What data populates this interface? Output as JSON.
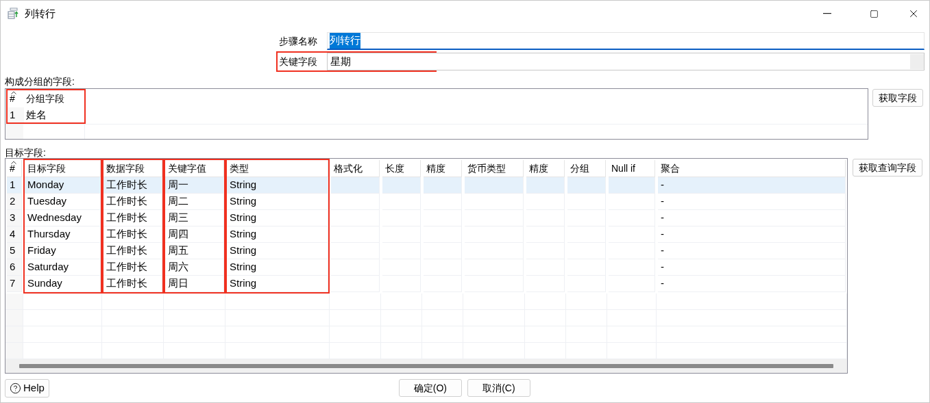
{
  "window": {
    "title": "列转行"
  },
  "step_name": {
    "label": "步骤名称",
    "value": "列转行",
    "text_selected": true
  },
  "key_field": {
    "label": "关键字段",
    "value": "星期",
    "highlighted": true
  },
  "group_fields": {
    "label": "构成分组的字段:",
    "highlighted": true,
    "columns": [
      "#",
      "分组字段"
    ],
    "rows": [
      [
        "1",
        "姓名"
      ]
    ],
    "button": "获取字段"
  },
  "target_fields": {
    "label": "目标字段:",
    "button": "获取查询字段",
    "columns": [
      {
        "label": "#",
        "highlighted": false
      },
      {
        "label": "目标字段",
        "highlighted": true
      },
      {
        "label": "数据字段",
        "highlighted": true
      },
      {
        "label": "关键字值",
        "highlighted": true
      },
      {
        "label": "类型",
        "highlighted": true
      },
      {
        "label": "格式化",
        "highlighted": false
      },
      {
        "label": "长度",
        "highlighted": false
      },
      {
        "label": "精度",
        "highlighted": false
      },
      {
        "label": "货币类型",
        "highlighted": false
      },
      {
        "label": "精度",
        "highlighted": false
      },
      {
        "label": "分组",
        "highlighted": false
      },
      {
        "label": "Null if",
        "highlighted": false
      },
      {
        "label": "聚合",
        "highlighted": false
      }
    ],
    "rows": [
      {
        "number": "1",
        "target": "Monday",
        "data": "工作时长",
        "key_value": "周一",
        "type": "String",
        "aggregate": "-",
        "selected": true
      },
      {
        "number": "2",
        "target": "Tuesday",
        "data": "工作时长",
        "key_value": "周二",
        "type": "String",
        "aggregate": "-",
        "selected": false
      },
      {
        "number": "3",
        "target": "Wednesday",
        "data": "工作时长",
        "key_value": "周三",
        "type": "String",
        "aggregate": "-",
        "selected": false
      },
      {
        "number": "4",
        "target": "Thursday",
        "data": "工作时长",
        "key_value": "周四",
        "type": "String",
        "aggregate": "-",
        "selected": false
      },
      {
        "number": "5",
        "target": "Friday",
        "data": "工作时长",
        "key_value": "周五",
        "type": "String",
        "aggregate": "-",
        "selected": false
      },
      {
        "number": "6",
        "target": "Saturday",
        "data": "工作时长",
        "key_value": "周六",
        "type": "String",
        "aggregate": "-",
        "selected": false
      },
      {
        "number": "7",
        "target": "Sunday",
        "data": "工作时长",
        "key_value": "周日",
        "type": "String",
        "aggregate": "-",
        "selected": false
      }
    ]
  },
  "help_button": "Help",
  "buttons": [
    "确定(O)",
    "取消(C)"
  ]
}
